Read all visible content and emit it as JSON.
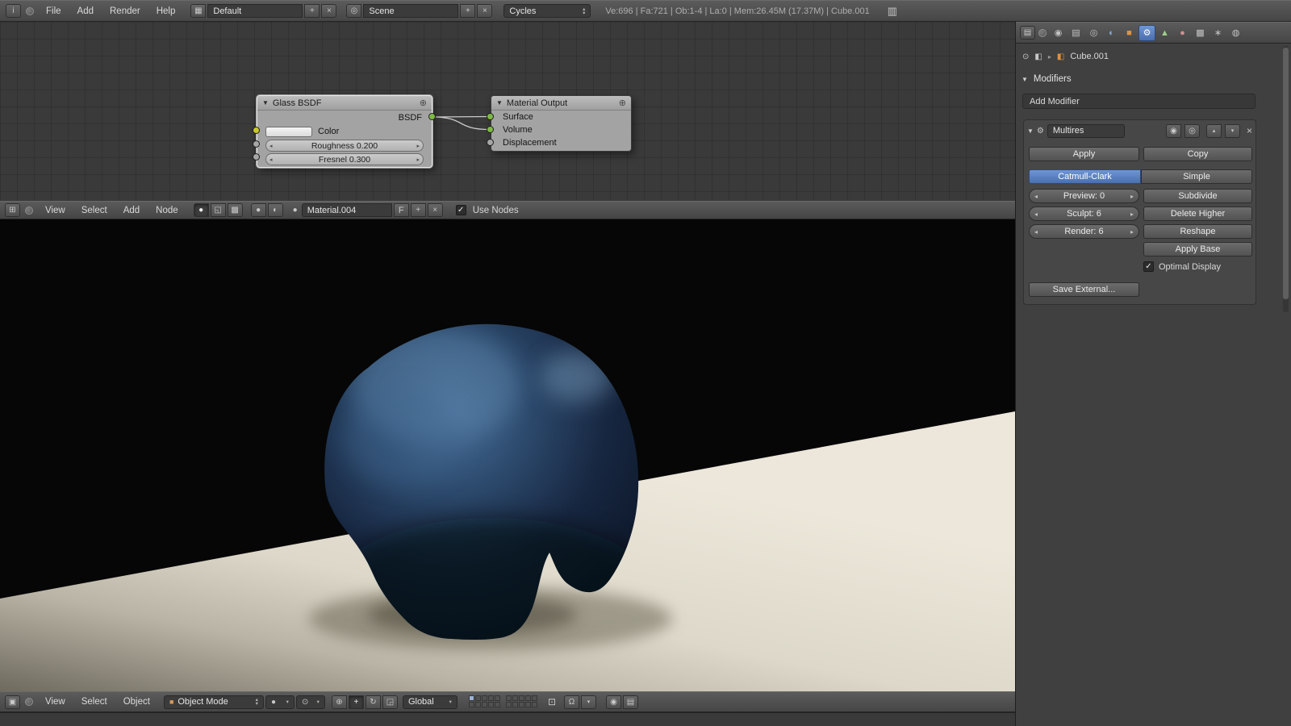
{
  "colors": {
    "accent_blue": "#5680c2",
    "selected_blue": "#4a6fae",
    "object_orange": "#e0913f",
    "socket_green": "#7dba45",
    "socket_yellow": "#c7c729",
    "socket_gray": "#a6a6a6",
    "floor_cream": "#e2ddcf",
    "elephant_blue": "#2c4a6d"
  },
  "icons": {
    "info": "i",
    "grid": "▦",
    "scene": "◎",
    "plus": "+",
    "close": "×",
    "tri_up": "▴",
    "tri_down": "▾",
    "tri_left": "◂",
    "tri_right": "▸",
    "tri_expand": "▼",
    "screen": "▥",
    "node_editor": "⊞",
    "material_ball": "●",
    "texture": "▩",
    "compositing": "◱",
    "world": "◐",
    "viewport_type": "▣",
    "cube": "■",
    "pivot": "⊙",
    "manipulator": "⊕",
    "translate": "+",
    "rotate": "↻",
    "scale": "◲",
    "lock": "⊡",
    "magnet": "Ω",
    "camera": "◉",
    "eye": "◎",
    "properties_type": "▤",
    "pin": "⊙",
    "object": "◧",
    "wrench": "⚙",
    "node_plus": "⊕",
    "check": "✓"
  },
  "top_header": {
    "menus": [
      "File",
      "Add",
      "Render",
      "Help"
    ],
    "layout_name": "Default",
    "scene_name": "Scene",
    "engine": "Cycles",
    "stats": "Ve:696 | Fa:721 | Ob:1-4 | La:0 | Mem:26.45M (17.37M) | Cube.001"
  },
  "node_editor": {
    "menus": [
      "View",
      "Select",
      "Add",
      "Node"
    ],
    "material_name": "Material.004",
    "fake_user": "F",
    "use_nodes": "Use Nodes",
    "glass_node": {
      "title": "Glass BSDF",
      "output": "BSDF",
      "color": "Color",
      "roughness": "Roughness 0.200",
      "fresnel": "Fresnel 0.300"
    },
    "output_node": {
      "title": "Material Output",
      "inputs": [
        "Surface",
        "Volume",
        "Displacement"
      ]
    }
  },
  "viewport_header": {
    "menus": [
      "View",
      "Select",
      "Object"
    ],
    "mode": "Object Mode",
    "orientation": "Global"
  },
  "properties_panel": {
    "tabs": [
      {
        "name": "render",
        "icon": "◉"
      },
      {
        "name": "render-layers",
        "icon": "▤"
      },
      {
        "name": "scene",
        "icon": "◎"
      },
      {
        "name": "world",
        "icon": "◐"
      },
      {
        "name": "object",
        "icon": "■"
      },
      {
        "name": "modifiers",
        "icon": "⚙"
      },
      {
        "name": "object-data",
        "icon": "▲"
      },
      {
        "name": "material",
        "icon": "●"
      },
      {
        "name": "texture",
        "icon": "▩"
      },
      {
        "name": "particles",
        "icon": "∗"
      },
      {
        "name": "physics",
        "icon": "◍"
      }
    ],
    "breadcrumb_object": "Cube.001",
    "section": "Modifiers",
    "add_modifier": "Add Modifier",
    "modifier": {
      "name": "Multires",
      "apply": "Apply",
      "copy": "Copy",
      "type_catmull": "Catmull-Clark",
      "type_simple": "Simple",
      "preview": "Preview: 0",
      "sculpt": "Sculpt: 6",
      "render": "Render: 6",
      "subdivide": "Subdivide",
      "delete_higher": "Delete Higher",
      "reshape": "Reshape",
      "apply_base": "Apply Base",
      "optimal_display": "Optimal Display",
      "save_external": "Save External..."
    }
  }
}
